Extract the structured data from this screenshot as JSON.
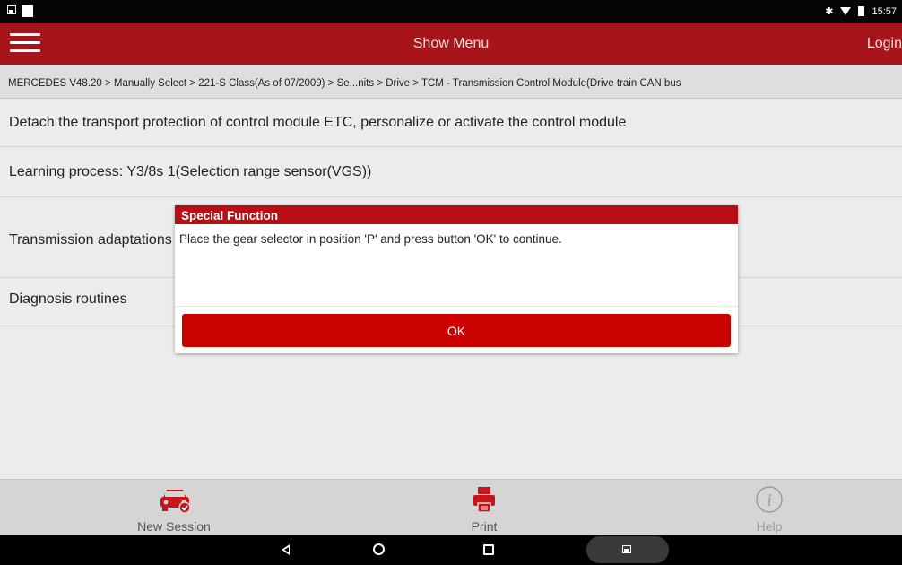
{
  "status_bar": {
    "time": "15:57",
    "bluetooth_icon": "bluetooth-icon",
    "wifi_icon": "wifi-icon",
    "battery_icon": "battery-icon"
  },
  "title_bar": {
    "menu_icon": "hamburger-menu-icon",
    "title": "Show Menu",
    "login_label": "Login"
  },
  "breadcrumb": "MERCEDES V48.20 > Manually Select > 221-S Class(As of 07/2009) > Se...nits > Drive > TCM - Transmission Control Module(Drive train CAN bus",
  "menu_items": [
    "Detach the transport protection of control module ETC, personalize or activate the control module",
    "Learning process: Y3/8s 1(Selection range sensor(VGS))",
    "Transmission adaptations",
    "Diagnosis routines"
  ],
  "dialog": {
    "title": "Special Function",
    "message": "Place the gear selector in position 'P' and press button 'OK' to continue.",
    "ok_label": "OK"
  },
  "toolbar": {
    "new_session": {
      "label": "New Session",
      "icon": "car-check-icon"
    },
    "print": {
      "label": "Print",
      "icon": "printer-icon"
    },
    "help": {
      "label": "Help",
      "icon": "info-icon"
    }
  },
  "colors": {
    "brand_red": "#a7141a",
    "button_red": "#cb0000",
    "dialog_title_red": "#b70f13"
  }
}
